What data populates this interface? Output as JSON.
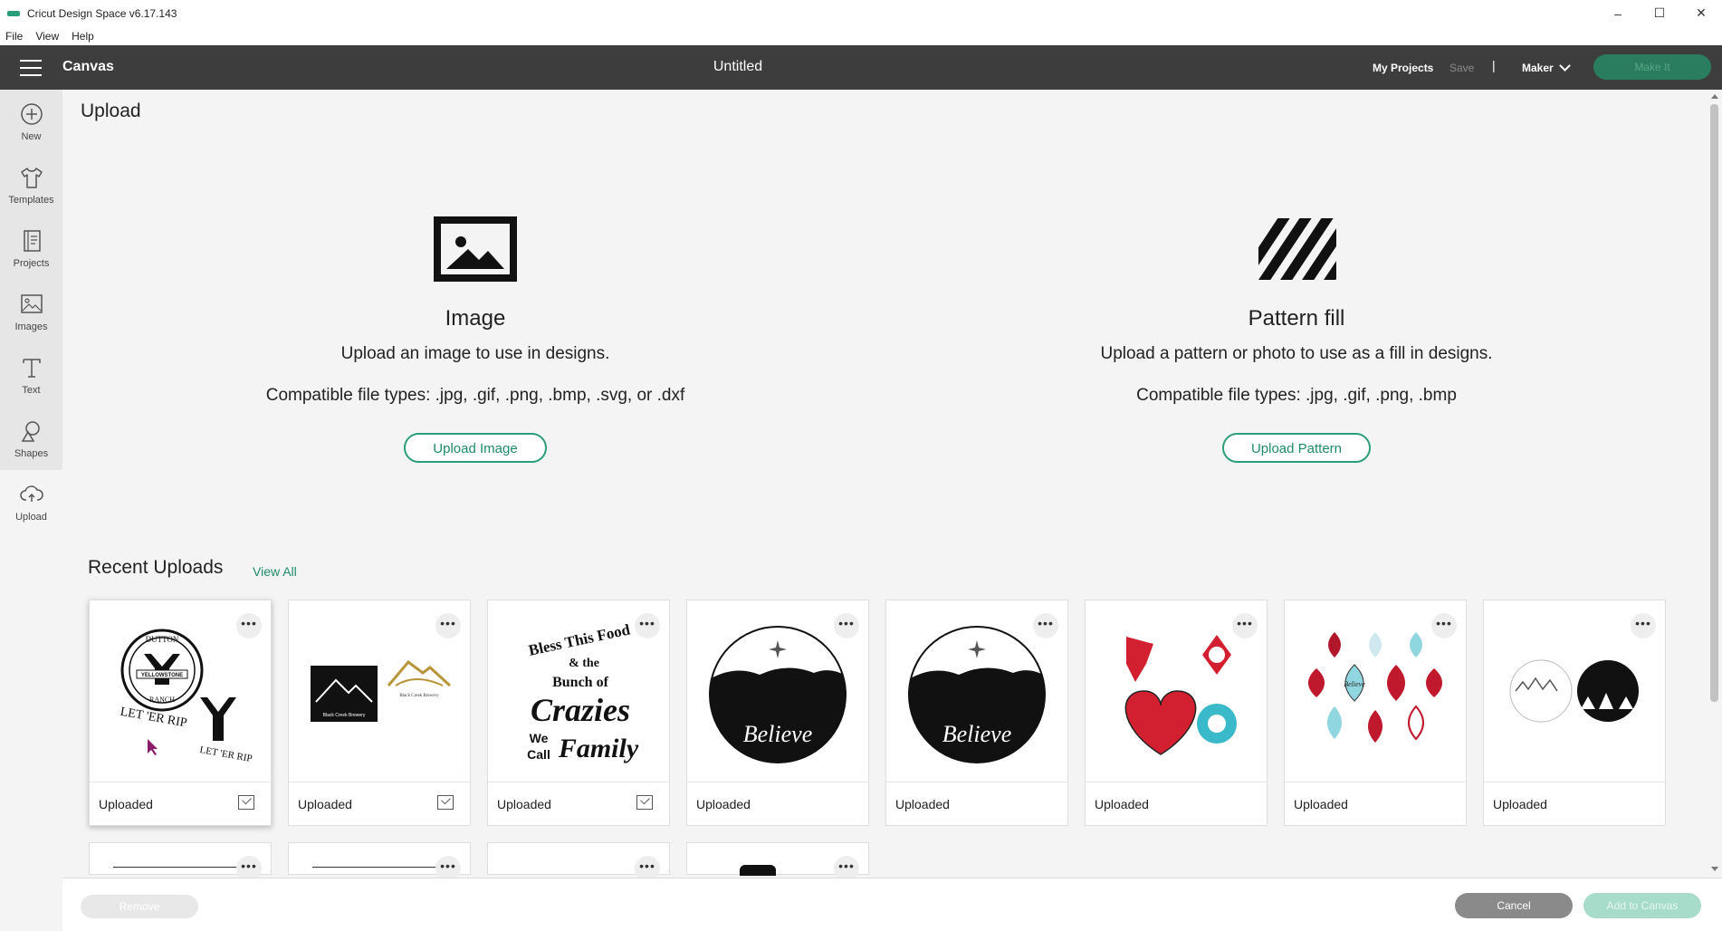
{
  "window": {
    "title": "Cricut Design Space  v6.17.143",
    "minimize": "–",
    "maximize": "☐",
    "close": "✕"
  },
  "menu": [
    "File",
    "View",
    "Help"
  ],
  "header": {
    "section": "Canvas",
    "document_title": "Untitled",
    "my_projects": "My Projects",
    "save": "Save",
    "separator": "|",
    "machine": "Maker",
    "make_it": "Make It"
  },
  "sidebar": {
    "items": [
      {
        "label": "New",
        "icon": "plus-circle-icon"
      },
      {
        "label": "Templates",
        "icon": "shirt-icon"
      },
      {
        "label": "Projects",
        "icon": "projects-icon"
      },
      {
        "label": "Images",
        "icon": "image-icon"
      },
      {
        "label": "Text",
        "icon": "text-icon"
      },
      {
        "label": "Shapes",
        "icon": "shapes-icon"
      },
      {
        "label": "Upload",
        "icon": "cloud-upload-icon"
      }
    ]
  },
  "upload": {
    "page_title": "Upload",
    "image": {
      "title": "Image",
      "description": "Upload an image to use in designs.",
      "file_types": "Compatible file types: .jpg, .gif, .png, .bmp, .svg, or .dxf",
      "button": "Upload Image"
    },
    "pattern": {
      "title": "Pattern fill",
      "description": "Upload a pattern or photo to use as a fill in designs.",
      "file_types": "Compatible file types: .jpg, .gif, .png, .bmp",
      "button": "Upload Pattern"
    }
  },
  "recent": {
    "title": "Recent Uploads",
    "view_all": "View All",
    "more_menu": "•••",
    "cards": [
      {
        "status": "Uploaded",
        "checked": true,
        "thumb": "Dutton Yellowstone Ranch let 'er rip design",
        "texts": [
          "DUTTON",
          "YELLOWSTONE",
          "RANCH",
          "LET 'ER RIP",
          "LET 'ER RIP"
        ]
      },
      {
        "status": "Uploaded",
        "checked": true,
        "thumb": "Black Creek Brewery logos",
        "texts": [
          "Black Creek Brewery",
          "Black Creek Brewery"
        ]
      },
      {
        "status": "Uploaded",
        "checked": true,
        "thumb": "Bless This Food typography",
        "texts": [
          "Bless This Food",
          "& the",
          "Bunch of",
          "Crazies",
          "We",
          "Call",
          "Family"
        ]
      },
      {
        "status": "Uploaded",
        "checked": false,
        "thumb": "Nativity Believe circle",
        "texts": [
          "Believe"
        ]
      },
      {
        "status": "Uploaded",
        "checked": false,
        "thumb": "Nativity Believe circle",
        "texts": [
          "Believe"
        ]
      },
      {
        "status": "Uploaded",
        "checked": false,
        "thumb": "Red ornaments and snowflake",
        "texts": []
      },
      {
        "status": "Uploaded",
        "checked": false,
        "thumb": "Lantern ornament shapes",
        "texts": [
          "Believe"
        ]
      },
      {
        "status": "Uploaded",
        "checked": false,
        "thumb": "Round ornament designs",
        "texts": []
      }
    ]
  },
  "footer": {
    "remove": "Remove",
    "cancel": "Cancel",
    "add_to_canvas": "Add to Canvas"
  }
}
